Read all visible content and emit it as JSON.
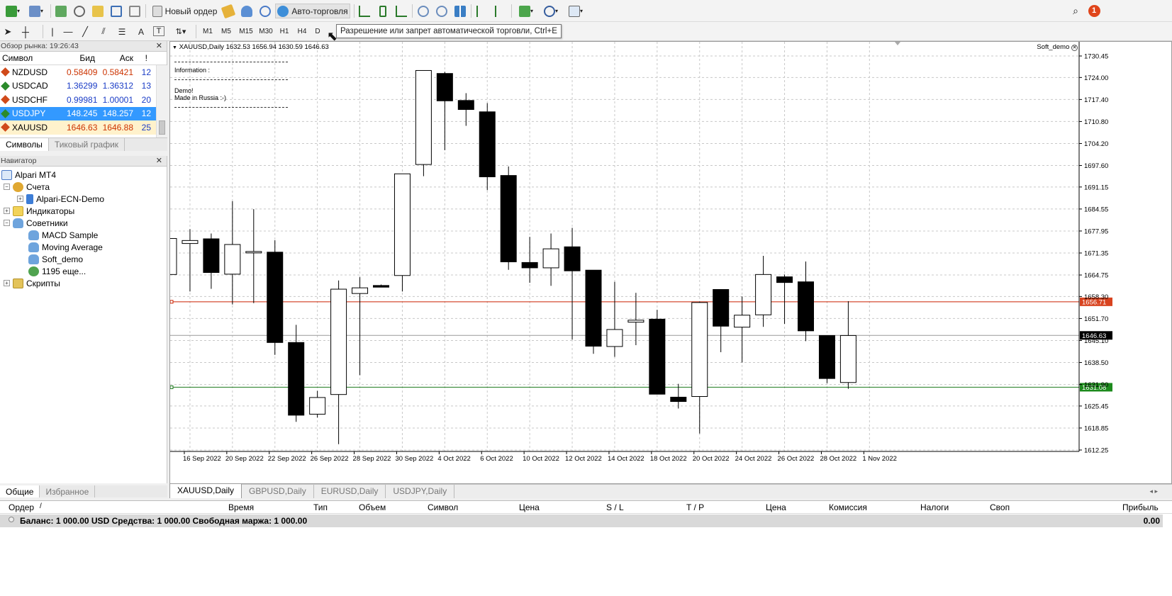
{
  "toolbar": {
    "new_order_label": "Новый ордер",
    "auto_trading_label": "Авто-торговля",
    "timeframes": [
      "M1",
      "M5",
      "M15",
      "M30",
      "H1",
      "H4",
      "D"
    ],
    "notification_count": "1",
    "tooltip": "Разрешение или запрет автоматической торговли, Ctrl+E"
  },
  "market_watch": {
    "title": "Обзор рынка: 19:26:43",
    "columns": [
      "Символ",
      "Бид",
      "Аск",
      "!"
    ],
    "rows": [
      {
        "symbol": "NZDUSD",
        "bid": "0.58409",
        "ask": "0.58421",
        "spread": "12",
        "color": "#cc3300"
      },
      {
        "symbol": "USDCAD",
        "bid": "1.36299",
        "ask": "1.36312",
        "spread": "13",
        "color": "#1a3cc6"
      },
      {
        "symbol": "USDCHF",
        "bid": "0.99981",
        "ask": "1.00001",
        "spread": "20",
        "color": "#1a3cc6"
      },
      {
        "symbol": "USDJPY",
        "bid": "148.245",
        "ask": "148.257",
        "spread": "12",
        "color": "#ffffff"
      },
      {
        "symbol": "XAUUSD",
        "bid": "1646.63",
        "ask": "1646.88",
        "spread": "25",
        "color": "#cc3300"
      }
    ],
    "tabs": [
      "Символы",
      "Тиковый график"
    ]
  },
  "navigator": {
    "title": "Навигатор",
    "root": "Alpari MT4",
    "accounts": "Счета",
    "account": "Alpari-ECN-Demo",
    "indicators": "Индикаторы",
    "experts": "Советники",
    "expert_items": [
      "MACD Sample",
      "Moving Average",
      "Soft_demo",
      "1195 еще..."
    ],
    "scripts": "Скрипты",
    "tabs": [
      "Общие",
      "Избранное"
    ]
  },
  "chart": {
    "header": "XAUUSD,Daily  1632.53 1656.94 1630.59 1646.63",
    "expert_name": "Soft_demo",
    "info_lines": [
      "Information :",
      "Demo!",
      "Made in Russia :-)"
    ],
    "price_labels": {
      "red_line": "1656.71",
      "current": "1646.63",
      "green_line": "1631.08"
    },
    "colors": {
      "red_line": "#cc2200",
      "green_line": "#1d7a1d",
      "grid": "#c8c8c8"
    },
    "tabs": [
      "XAUUSD,Daily",
      "GBPUSD,Daily",
      "EURUSD,Daily",
      "USDJPY,Daily"
    ]
  },
  "chart_data": {
    "type": "candlestick",
    "symbol": "XAUUSD",
    "timeframe": "Daily",
    "y_ticks": [
      1730.45,
      1724.0,
      1717.4,
      1710.8,
      1704.2,
      1697.6,
      1691.15,
      1684.55,
      1677.95,
      1671.35,
      1664.75,
      1658.3,
      1651.7,
      1645.1,
      1638.5,
      1631.9,
      1625.45,
      1618.85,
      1612.25
    ],
    "ylim": [
      1612.25,
      1730.45
    ],
    "x_labels": [
      "16 Sep 2022",
      "20 Sep 2022",
      "22 Sep 2022",
      "26 Sep 2022",
      "28 Sep 2022",
      "30 Sep 2022",
      "4 Oct 2022",
      "6 Oct 2022",
      "10 Oct 2022",
      "12 Oct 2022",
      "14 Oct 2022",
      "18 Oct 2022",
      "20 Oct 2022",
      "24 Oct 2022",
      "26 Oct 2022",
      "28 Oct 2022",
      "1 Nov 2022"
    ],
    "candles": [
      {
        "o": 1664.9,
        "h": 1678.5,
        "l": 1663.0,
        "c": 1675.7
      },
      {
        "o": 1674.2,
        "h": 1678.5,
        "l": 1659.8,
        "c": 1675.1
      },
      {
        "o": 1675.6,
        "h": 1677.2,
        "l": 1660.6,
        "c": 1665.5
      },
      {
        "o": 1665.0,
        "h": 1686.9,
        "l": 1655.9,
        "c": 1673.9
      },
      {
        "o": 1671.7,
        "h": 1684.5,
        "l": 1656.3,
        "c": 1671.8
      },
      {
        "o": 1671.6,
        "h": 1675.2,
        "l": 1640.8,
        "c": 1644.5
      },
      {
        "o": 1644.5,
        "h": 1649.8,
        "l": 1620.7,
        "c": 1622.7
      },
      {
        "o": 1623.0,
        "h": 1630.0,
        "l": 1622.0,
        "c": 1628.0
      },
      {
        "o": 1628.9,
        "h": 1663.1,
        "l": 1614.0,
        "c": 1660.5
      },
      {
        "o": 1659.2,
        "h": 1664.1,
        "l": 1634.7,
        "c": 1660.9
      },
      {
        "o": 1661.6,
        "h": 1661.9,
        "l": 1661.1,
        "c": 1661.1
      },
      {
        "o": 1664.6,
        "h": 1673.5,
        "l": 1659.8,
        "c": 1695.1
      },
      {
        "o": 1697.9,
        "h": 1724.3,
        "l": 1694.4,
        "c": 1726.1
      },
      {
        "o": 1725.2,
        "h": 1725.7,
        "l": 1702.2,
        "c": 1717.0
      },
      {
        "o": 1717.1,
        "h": 1719.3,
        "l": 1709.5,
        "c": 1714.4
      },
      {
        "o": 1713.7,
        "h": 1716.3,
        "l": 1690.2,
        "c": 1694.2
      },
      {
        "o": 1694.6,
        "h": 1697.3,
        "l": 1666.3,
        "c": 1668.7
      },
      {
        "o": 1668.5,
        "h": 1676.2,
        "l": 1662.4,
        "c": 1666.9
      },
      {
        "o": 1666.9,
        "h": 1677.2,
        "l": 1661.5,
        "c": 1672.6
      },
      {
        "o": 1673.2,
        "h": 1678.9,
        "l": 1645.4,
        "c": 1666.0
      },
      {
        "o": 1666.2,
        "h": 1666.2,
        "l": 1641.1,
        "c": 1643.4
      },
      {
        "o": 1643.3,
        "h": 1662.7,
        "l": 1640.2,
        "c": 1648.4
      },
      {
        "o": 1650.6,
        "h": 1659.4,
        "l": 1643.7,
        "c": 1651.2
      },
      {
        "o": 1651.5,
        "h": 1654.3,
        "l": 1629.1,
        "c": 1629.0
      },
      {
        "o": 1628.1,
        "h": 1632.1,
        "l": 1624.7,
        "c": 1626.8
      },
      {
        "o": 1628.3,
        "h": 1656.8,
        "l": 1617.2,
        "c": 1656.5
      },
      {
        "o": 1660.4,
        "h": 1660.5,
        "l": 1641.6,
        "c": 1649.4
      },
      {
        "o": 1649.1,
        "h": 1658.3,
        "l": 1638.5,
        "c": 1652.7
      },
      {
        "o": 1652.8,
        "h": 1670.5,
        "l": 1649.2,
        "c": 1664.9
      },
      {
        "o": 1664.2,
        "h": 1664.9,
        "l": 1650.1,
        "c": 1662.5
      },
      {
        "o": 1662.7,
        "h": 1668.8,
        "l": 1644.9,
        "c": 1648.0
      },
      {
        "o": 1646.6,
        "h": 1646.6,
        "l": 1632.3,
        "c": 1633.7
      },
      {
        "o": 1632.5,
        "h": 1656.9,
        "l": 1630.6,
        "c": 1646.6
      }
    ],
    "lines": [
      {
        "name": "red",
        "value": 1656.71
      },
      {
        "name": "current",
        "value": 1646.63
      },
      {
        "name": "green",
        "value": 1631.08
      }
    ]
  },
  "terminal": {
    "columns": [
      "Ордер",
      "/",
      "Время",
      "Тип",
      "Объем",
      "Символ",
      "Цена",
      "S / L",
      "T / P",
      "Цена",
      "Комиссия",
      "Налоги",
      "Своп",
      "Прибыль"
    ],
    "balance_text": "Баланс: 1 000.00 USD  Средства: 1 000.00  Свободная маржа: 1 000.00",
    "profit": "0.00"
  }
}
